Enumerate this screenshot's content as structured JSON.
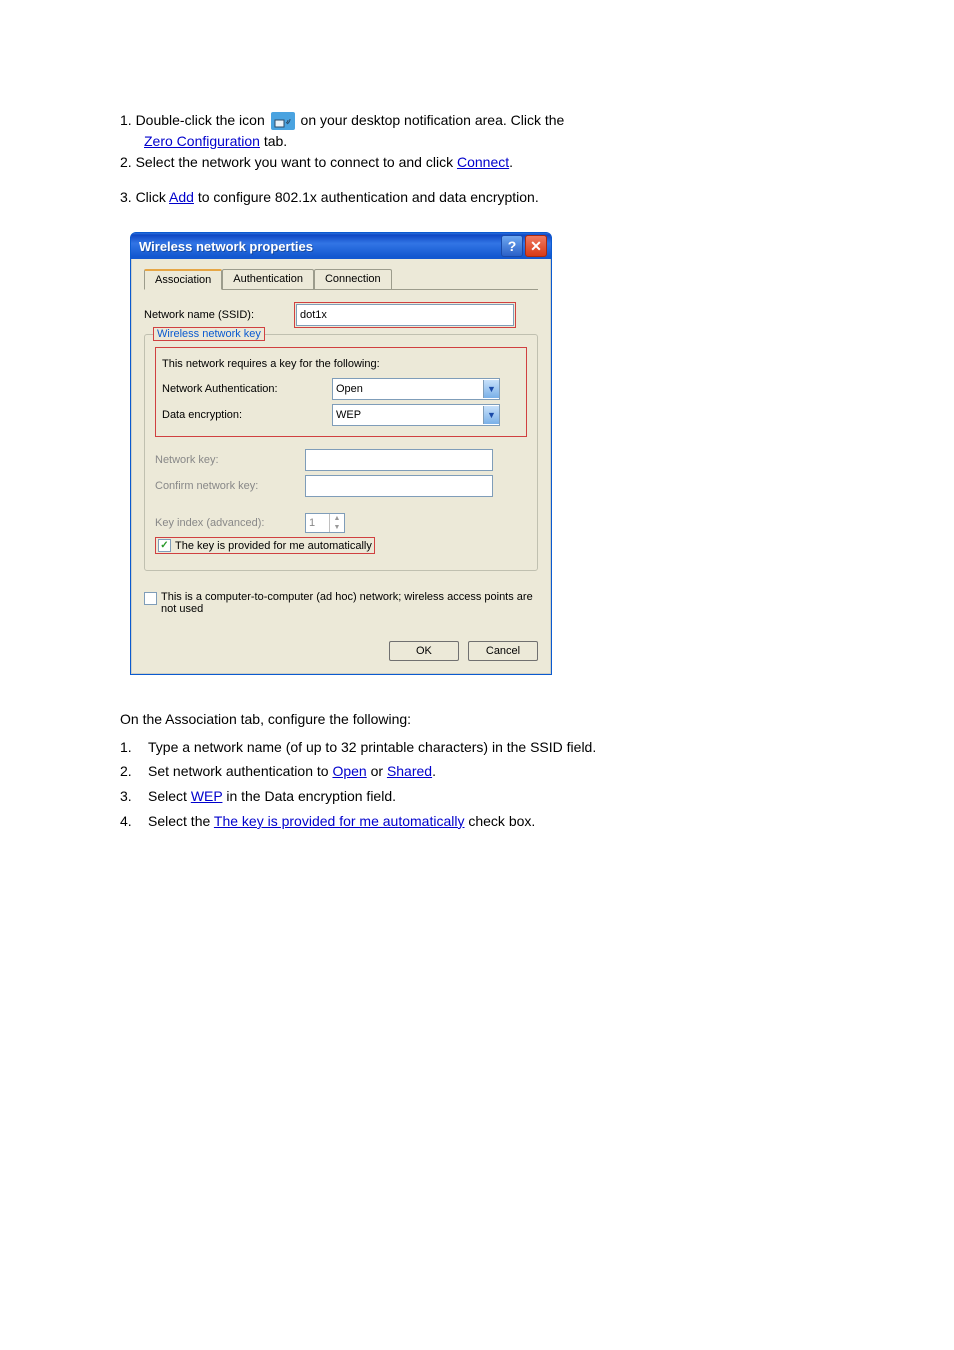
{
  "pre_dialog": {
    "line1_before_icon": "1. Double-click the icon",
    "line1_after_icon": "on your desktop notification area. Click the",
    "line2_label": "Zero Configuration",
    "line2_tab": " tab.",
    "line3": "2. Select the network you want to connect to and click ",
    "line3_link": "Connect",
    "line3_after": ".",
    "line4_before": "3. Click ",
    "line4_link": "Add",
    "line4_after": " to configure 802.1x authentication and data encryption."
  },
  "dialog": {
    "title": "Wireless network properties",
    "tabs": [
      "Association",
      "Authentication",
      "Connection"
    ],
    "ssid_label": "Network name (SSID):",
    "ssid_value": "dot1x",
    "legend": "Wireless network key",
    "key_text": "This network requires a key for the following:",
    "auth_label": "Network Authentication:",
    "auth_value": "Open",
    "enc_label": "Data encryption:",
    "enc_value": "WEP",
    "netkey_label": "Network key:",
    "confirm_label": "Confirm network key:",
    "keyidx_label": "Key index (advanced):",
    "keyidx_value": "1",
    "auto_key_label": "The key is provided for me automatically",
    "adhoc_label": "This is a computer-to-computer (ad hoc) network; wireless access points are not used",
    "ok": "OK",
    "cancel": "Cancel"
  },
  "post_dialog": {
    "intro": "On the Association tab, configure the following:",
    "items": {
      "n1_num": "1.",
      "n1": "Type a network name (of up to 32 printable characters) in the SSID field.",
      "n2_num": "2.",
      "n2a": "Set network authentication to ",
      "n2_link1": "Open",
      "n2b": " or ",
      "n2_link2": "Shared",
      "n2_period": ".",
      "n3_num": "3.",
      "n4_num": "4.",
      "n3_label": "Select ",
      "n3_link": "WEP",
      "n3_after": " in the Data encryption field.",
      "n4_before": "Select the ",
      "n4_link": "The key is provided for me automatically",
      "n4_after": " check box."
    }
  }
}
